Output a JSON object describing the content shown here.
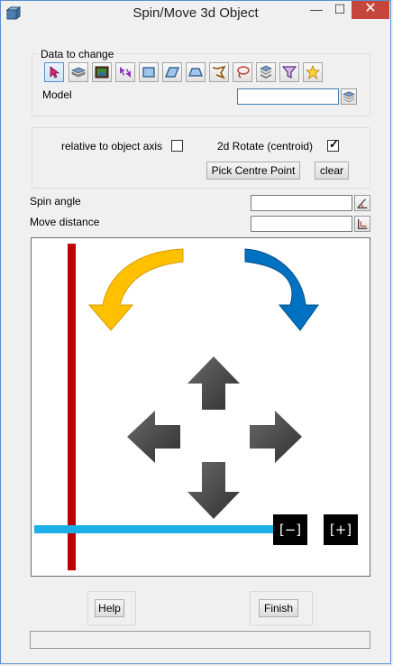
{
  "window": {
    "title": "Spin/Move 3d Object",
    "minimize_glyph": "—",
    "maximize_glyph": "☐",
    "close_glyph": "✕"
  },
  "data_group": {
    "legend": "Data to change",
    "tools": [
      {
        "name": "pick-cursor-icon"
      },
      {
        "name": "layers-icon"
      },
      {
        "name": "picture-frame-icon"
      },
      {
        "name": "arrows-pick-icon"
      },
      {
        "name": "rectangle-icon"
      },
      {
        "name": "parallelogram-icon"
      },
      {
        "name": "polygon-icon"
      },
      {
        "name": "polyline-icon"
      },
      {
        "name": "lasso-icon"
      },
      {
        "name": "stack-icon"
      },
      {
        "name": "filter-icon"
      },
      {
        "name": "star-icon"
      }
    ],
    "model_label": "Model",
    "model_value": ""
  },
  "options_group": {
    "relative_label": "relative to object axis",
    "relative_checked": false,
    "rotate_label": "2d Rotate (centroid)",
    "rotate_checked": true,
    "check_glyph": "✓",
    "pick_centre_label": "Pick Centre Point",
    "clear_label": "clear"
  },
  "spin": {
    "label": "Spin angle",
    "value": ""
  },
  "move": {
    "label": "Move distance",
    "value": ""
  },
  "canvas": {
    "zoom_out": "[−]",
    "zoom_in": "[+]",
    "colors": {
      "red_axis": "#c00000",
      "blue_axis": "#1aafe6",
      "ccw_arrow": "#ffc000",
      "cw_arrow": "#0070c0",
      "move_arrow": "#4a4a4a"
    }
  },
  "footer": {
    "help_label": "Help",
    "finish_label": "Finish",
    "status_text": ""
  }
}
